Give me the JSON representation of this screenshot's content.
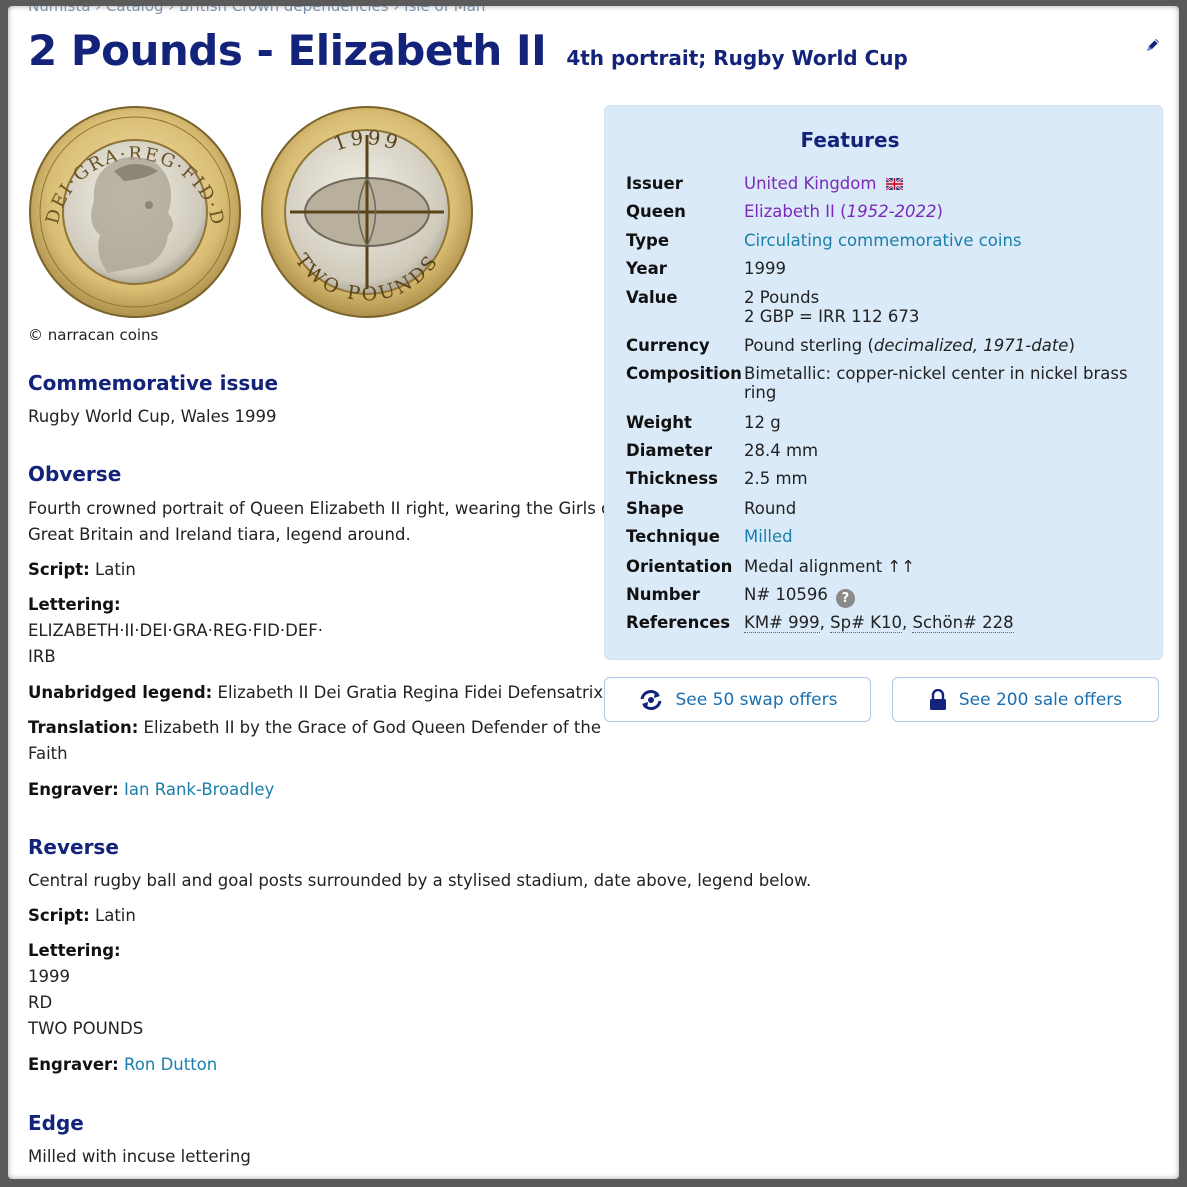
{
  "breadcrumb": "Numista › Catalog › British Crown dependencies › Isle of Man",
  "title": {
    "main": "2 Pounds - Elizabeth II",
    "subtitle": "4th portrait; Rugby World Cup"
  },
  "icons": {
    "edit": "pencil-icon",
    "swap": "swap-icon",
    "sale": "lock-icon",
    "help": "question-icon",
    "flag": "uk-flag-icon"
  },
  "colors": {
    "heading": "#13237a",
    "link": "#1a7faa",
    "visited_link": "#7a2ab8",
    "features_bg": "#dbeaf8"
  },
  "image_credit": "© narracan coins",
  "commemorative": {
    "heading": "Commemorative issue",
    "text": "Rugby World Cup, Wales 1999"
  },
  "obverse": {
    "heading": "Obverse",
    "description_line1": "Fourth crowned portrait of Queen Elizabeth II right, wearing the Girls of",
    "description_line2": "Great Britain and Ireland tiara, legend around.",
    "script_label": "Script:",
    "script_value": "Latin",
    "lettering_label": "Lettering:",
    "lettering_lines": [
      "ELIZABETH·II·DEI·GRA·REG·FID·DEF·",
      "IRB"
    ],
    "unabridged_label": "Unabridged legend:",
    "unabridged_value": "Elizabeth II Dei Gratia Regina Fidei Defensatrix",
    "translation_label": "Translation:",
    "translation_line1": "Elizabeth II by the Grace of God Queen Defender of the",
    "translation_line2": "Faith",
    "engraver_label": "Engraver:",
    "engraver_value": "Ian Rank-Broadley"
  },
  "reverse": {
    "heading": "Reverse",
    "description": "Central rugby ball and goal posts surrounded by a stylised stadium, date above, legend below.",
    "script_label": "Script:",
    "script_value": "Latin",
    "lettering_label": "Lettering:",
    "lettering_lines": [
      "1999",
      "RD",
      "TWO POUNDS"
    ],
    "engraver_label": "Engraver:",
    "engraver_value": "Ron Dutton"
  },
  "edge": {
    "heading": "Edge",
    "text": "Milled with incuse lettering"
  },
  "features": {
    "heading": "Features",
    "issuer_label": "Issuer",
    "issuer_value": "United Kingdom",
    "queen_label": "Queen",
    "queen_value": "Elizabeth II",
    "queen_years": "1952-2022",
    "type_label": "Type",
    "type_value": "Circulating commemorative coins",
    "year_label": "Year",
    "year_value": "1999",
    "value_label": "Value",
    "value_line1": "2 Pounds",
    "value_line2": "2 GBP = IRR 112 673",
    "currency_label": "Currency",
    "currency_value": "Pound sterling",
    "currency_note": "decimalized, 1971-date",
    "composition_label": "Composition",
    "composition_line1": "Bimetallic: copper-nickel center in nickel brass",
    "composition_line2": "ring",
    "weight_label": "Weight",
    "weight_value": "12 g",
    "diameter_label": "Diameter",
    "diameter_value": "28.4 mm",
    "thickness_label": "Thickness",
    "thickness_value": "2.5 mm",
    "shape_label": "Shape",
    "shape_value": "Round",
    "technique_label": "Technique",
    "technique_value": "Milled",
    "orientation_label": "Orientation",
    "orientation_value": "Medal alignment ↑↑",
    "number_label": "Number",
    "number_value": "N# 10596",
    "references_label": "References",
    "ref_km": "KM# 999",
    "ref_sp": "Sp# K10",
    "ref_schon": "Schön# 228"
  },
  "offers": {
    "swap_label": "See 50 swap offers",
    "sale_label": "See 200 sale offers"
  },
  "coin_legends": {
    "obverse_top": "DEI·GRA·REG·FID·DEF",
    "obverse_left": "ELIZABETH·II",
    "reverse_year": "1999",
    "reverse_bottom": "TWO POUNDS"
  }
}
